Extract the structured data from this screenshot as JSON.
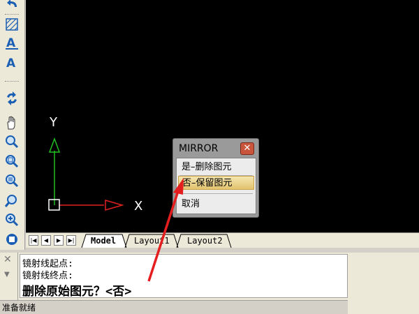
{
  "canvas": {
    "axis_x_label": "X",
    "axis_y_label": "Y",
    "background": "#000000"
  },
  "toolbar": {
    "icons": [
      "hatch-icon",
      "multiline-text-icon",
      "text-icon",
      "redraw-icon",
      "pan-icon",
      "zoom-realtime-icon",
      "zoom-window-icon",
      "zoom-previous-icon",
      "zoom-scale-icon",
      "zoom-in-icon",
      "zoom-extents-icon"
    ]
  },
  "popup": {
    "title": "MIRROR",
    "close_glyph": "✕",
    "items": [
      {
        "label": "是–删除图元",
        "highlighted": false
      },
      {
        "label": "否–保留图元",
        "highlighted": true
      },
      {
        "label": "取消",
        "highlighted": false
      }
    ]
  },
  "tabs": {
    "nav": [
      "|◀",
      "◀",
      "▶",
      "▶|"
    ],
    "items": [
      {
        "label": "Model",
        "active": true
      },
      {
        "label": "Layout1",
        "active": false
      },
      {
        "label": "Layout2",
        "active": false
      }
    ]
  },
  "command": {
    "close_glyph": "✕",
    "lines": [
      "镜射线起点:",
      "镜射线终点:"
    ],
    "prompt": "删除原始图元？<否>"
  },
  "status": {
    "text": "准备就绪"
  },
  "colors": {
    "x_axis": "#e02020",
    "y_axis": "#20c020",
    "annotation": "#e41e1e",
    "highlight": "#e3c36e"
  }
}
